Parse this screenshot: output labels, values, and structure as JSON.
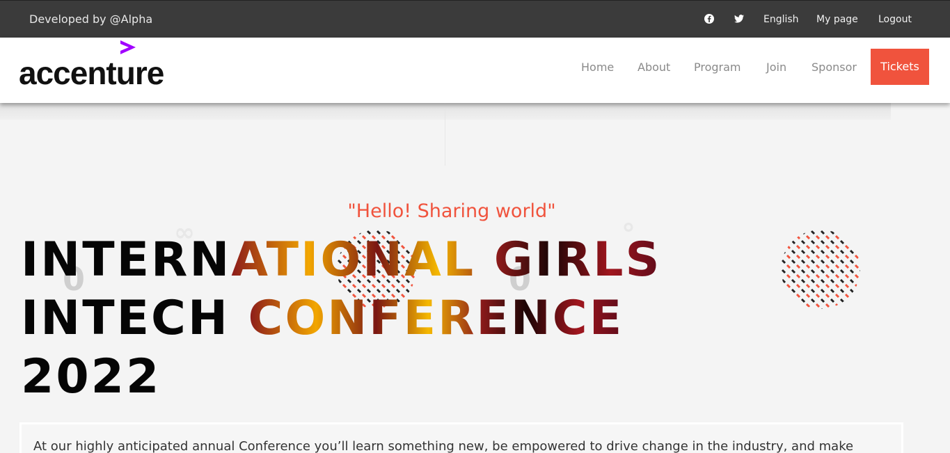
{
  "topbar": {
    "developer": "Developed by @Alpha",
    "social": [
      "facebook-icon",
      "twitter-icon"
    ],
    "language": "English",
    "my_page": "My page",
    "logout": "Logout"
  },
  "header": {
    "logo_text": "accenture",
    "nav": {
      "home": "Home",
      "about": "About",
      "program": "Program",
      "join": "Join",
      "sponsor": "Sponsor",
      "tickets": "Tickets"
    }
  },
  "hero": {
    "tagline": "\"Hello! Sharing world\"",
    "title_line1_a": "INTERN",
    "title_line1_b": "ATIONAL GIRLS",
    "title_line2_a": "INTECH ",
    "title_line2_b": "CONFERENCE",
    "title_line3": "2022",
    "description": "At our highly anticipated annual Conference you’ll learn something new, be empowered to drive change in the industry, and make"
  },
  "colors": {
    "accent": "#f0533d",
    "topbar_bg": "#3b3b3b",
    "logo_mark": "#a100ff"
  }
}
